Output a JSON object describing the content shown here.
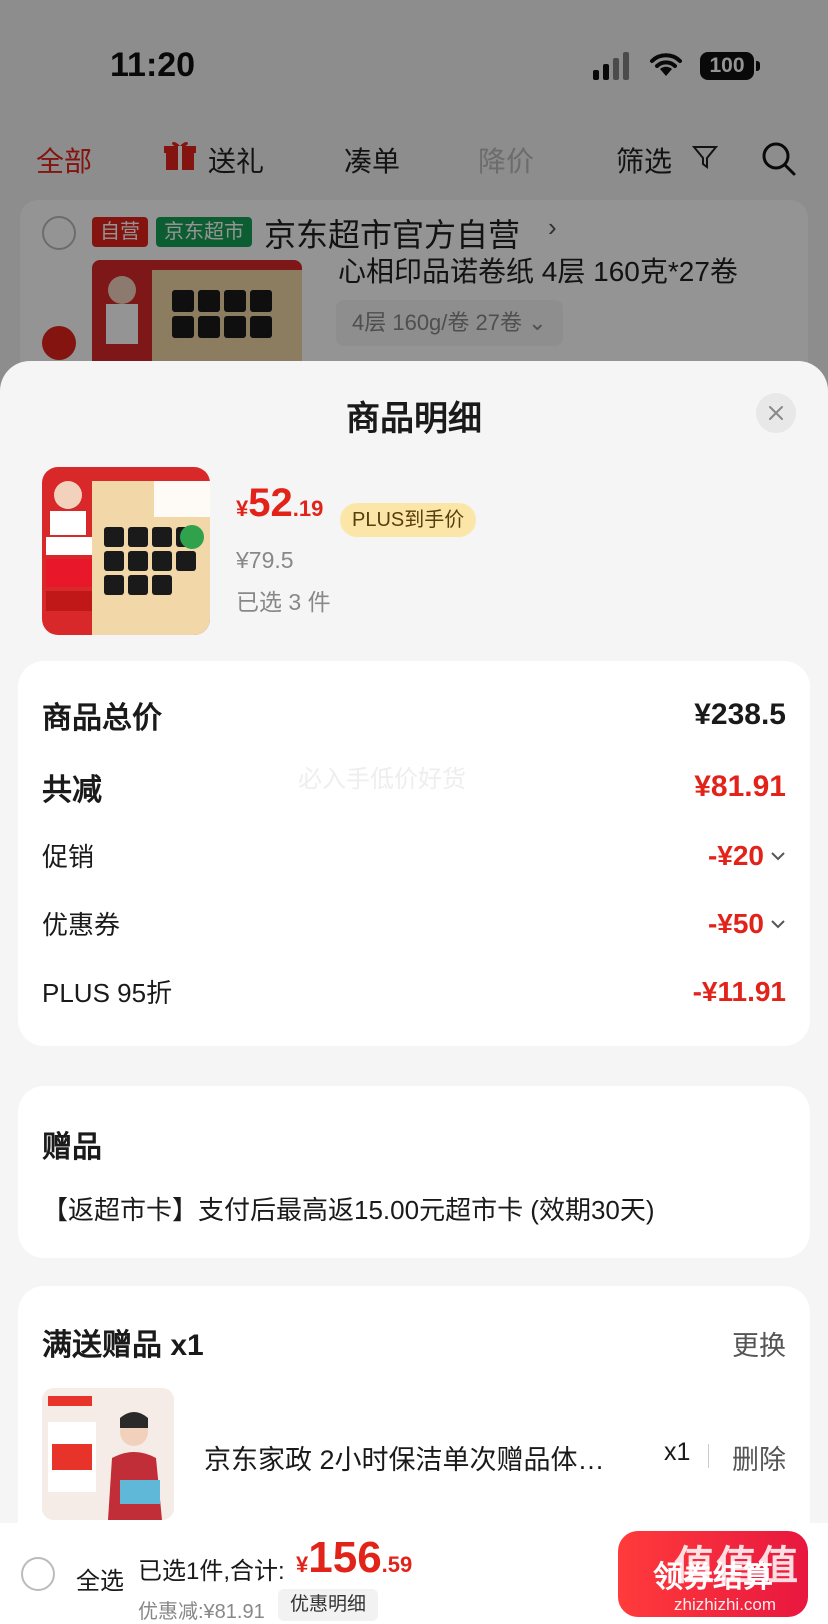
{
  "status_bar": {
    "time": "11:20",
    "battery": "100"
  },
  "top_tabs": [
    {
      "label": "全部"
    },
    {
      "label": "送礼"
    },
    {
      "label": "凑单"
    },
    {
      "label": "降价"
    },
    {
      "label": "筛选"
    }
  ],
  "shop": {
    "badge_self": "自营",
    "badge_market": "京东超市",
    "name": "京东超市官方自营",
    "product_title": "心相印品诺卷纸 4层 160克*27卷",
    "spec": "4层 160g/卷 27卷"
  },
  "sheet": {
    "title": "商品明细",
    "product": {
      "price_symbol": "¥",
      "price_int": "52",
      "price_dec": ".19",
      "plus_tag": "PLUS到手价",
      "original_price": "¥79.5",
      "selected_count": "已选 3 件"
    },
    "summary": {
      "total_label": "商品总价",
      "total_value": "¥238.5",
      "reduce_label": "共减",
      "reduce_value": "¥81.91",
      "watermark": "必入手低价好货",
      "promo_label": "促销",
      "promo_value": "-¥20",
      "coupon_label": "优惠券",
      "coupon_value": "-¥50",
      "plus_label": "PLUS 95折",
      "plus_value": "-¥11.91"
    },
    "gift": {
      "title": "赠品",
      "desc": "【返超市卡】支付后最高返15.00元超市卡 (效期30天)"
    },
    "free_gift": {
      "title": "满送赠品 x1",
      "change": "更换",
      "item_name": "京东家政 2小时保洁单次赠品体…",
      "item_qty": "x1",
      "delete": "删除"
    }
  },
  "bottom_bar": {
    "select_all": "全选",
    "summary": "已选1件,合计:",
    "total_symbol": "¥",
    "total_int": "156",
    "total_dec": ".59",
    "discount": "优惠减:¥81.91",
    "detail_btn": "优惠明细",
    "checkout": "领券结算",
    "watermark_logo": "值值值",
    "watermark_url": "zhizhizhi.com"
  },
  "colors": {
    "accent": "#e2231a",
    "plus_bg": "#fbe6a8"
  }
}
